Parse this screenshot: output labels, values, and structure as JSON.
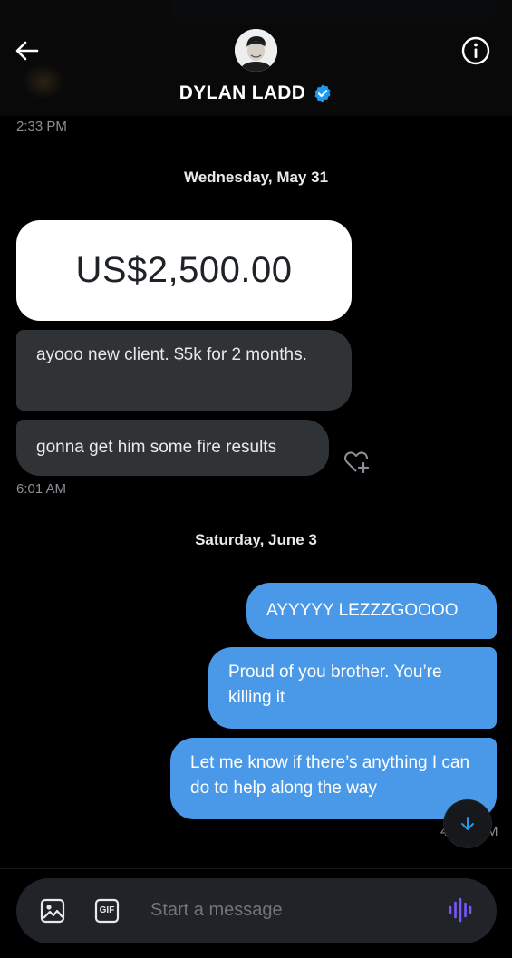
{
  "header": {
    "contact_name": "DYLAN LADD",
    "verified": true,
    "back_icon": "arrow-left-icon",
    "info_icon": "info-icon"
  },
  "messages_top_time": "2:33 PM",
  "sections": [
    {
      "date": "Wednesday, May 31",
      "image_card_text": "US$2,500.00",
      "incoming": [
        "ayooo new client. $5k for 2 months.",
        "gonna get him some fire results"
      ],
      "time": "6:01 AM"
    },
    {
      "date": "Saturday, June 3",
      "outgoing": [
        "AYYYYY LEZZZGOOOO",
        "Proud of you brother. You’re killing it",
        "Let me know if there’s anything I can do to help along the way"
      ],
      "time_partial": "4",
      "time_partial_end": "M"
    }
  ],
  "composer": {
    "placeholder": "Start a message",
    "gif_label": "GIF"
  },
  "colors": {
    "outgoing_bubble": "#4a99e9",
    "incoming_bubble": "#2f3336",
    "verified": "#1d9bf0",
    "voice_accent": "#7856ff"
  }
}
